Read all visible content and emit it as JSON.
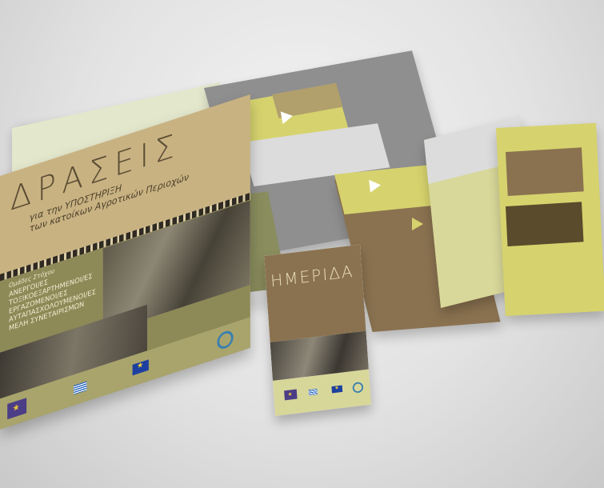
{
  "cover": {
    "title": "ΔΡΑΣΕΙΣ",
    "subtitle_line1": "για την ΥΠΟΣΤΗΡΙΞΗ",
    "subtitle_line2": "των κατοίκων Αγροτικών Περιοχών",
    "groups_title": "Ομάδες Στόχου",
    "groups": [
      "ΑΝΕΡΓΟΙ/ΕΣ",
      "ΤΟΞΙΚΟΕΞΑΡΤΗΜΕΝΟΙ/ΕΣ",
      "ΕΡΓΑΖΟΜΕΝΟΙ/ΕΣ",
      "ΑΥΤΑΠΑΣΧΟΛΟΥΜΕΝΟΙ/ΕΣ",
      "ΜΕΛΗ ΣΥΝΕΤΑΙΡΙΣΜΩΝ"
    ]
  },
  "leaflet": {
    "title": "ΗΜΕΡΙΔΑ"
  },
  "colors": {
    "tan": "#c9b282",
    "olive": "#8e8a58",
    "brown": "#8a7250",
    "lime": "#d6d36e",
    "grey_folder": "#8f8f8f",
    "pale_green": "#e3e7cc"
  },
  "icons": [
    "eu-flag-icon",
    "greece-flag-icon",
    "circle-logo-icon",
    "purple-logo-icon",
    "arrow-right-icon"
  ]
}
